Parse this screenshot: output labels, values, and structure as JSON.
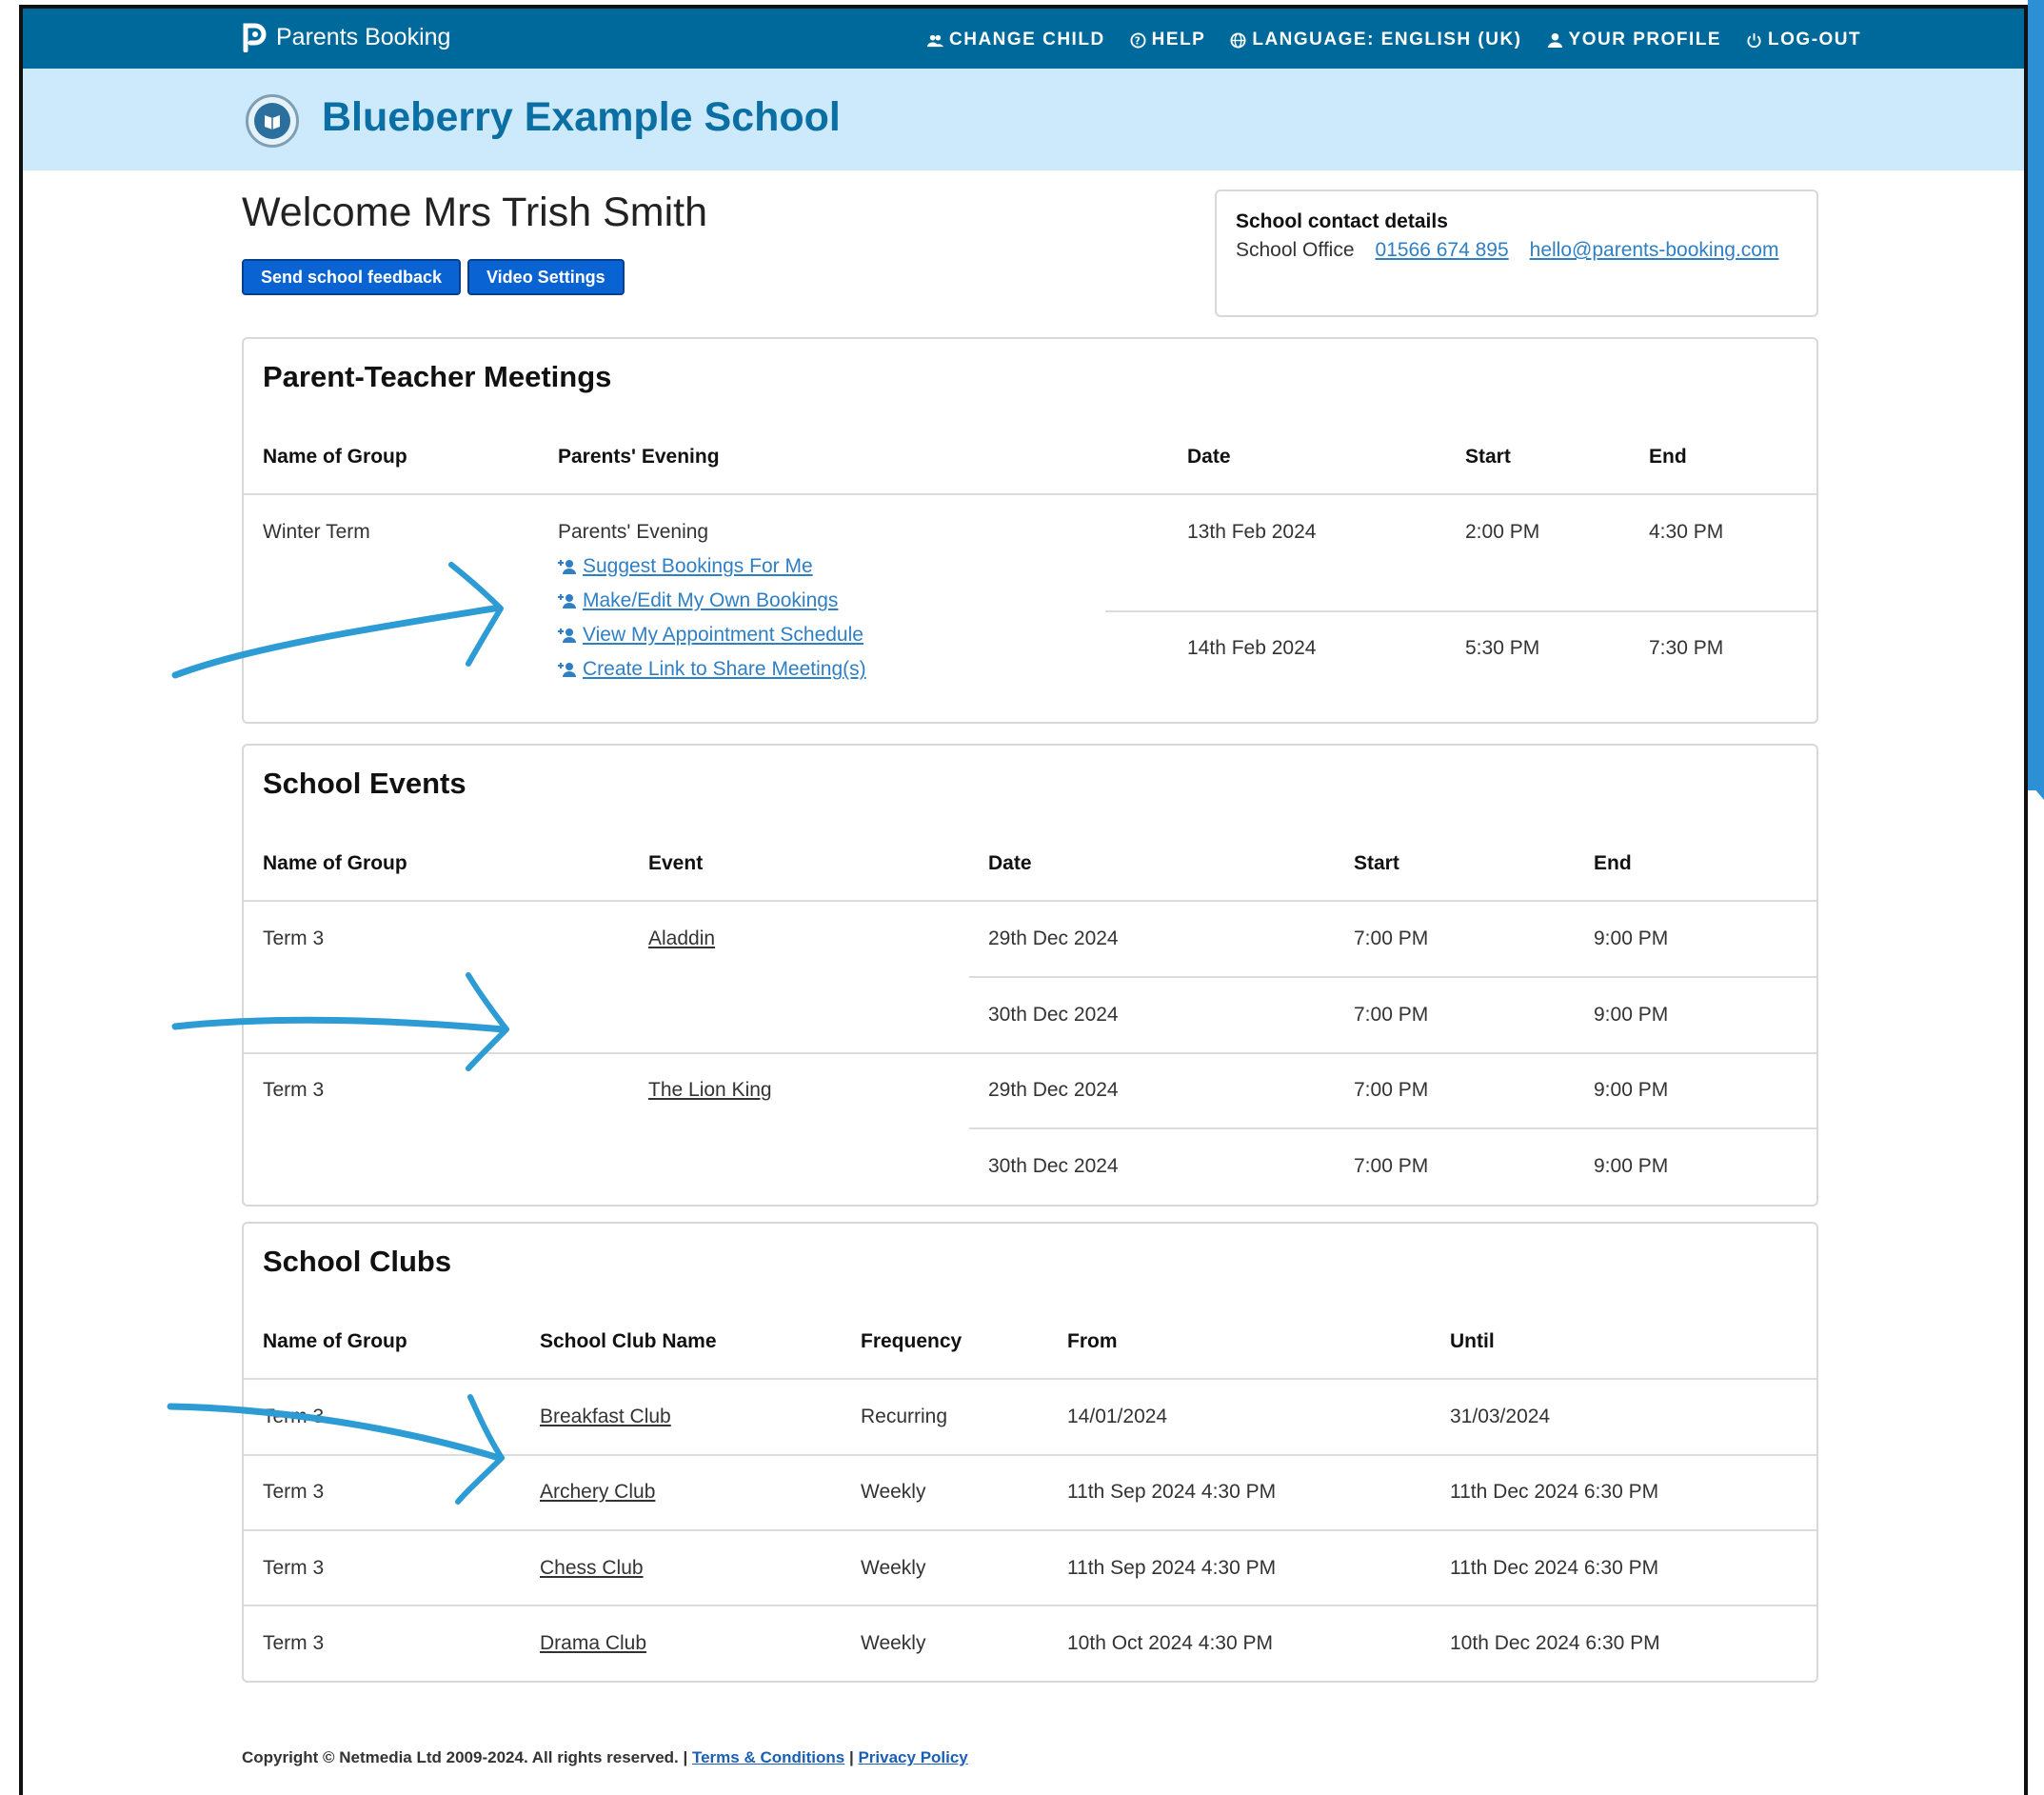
{
  "nav": {
    "brand": "Parents Booking",
    "items": [
      {
        "label": "CHANGE CHILD",
        "icon": "users-icon"
      },
      {
        "label": "HELP",
        "icon": "help-icon"
      },
      {
        "label": "LANGUAGE: ENGLISH (UK)",
        "icon": "globe-icon"
      },
      {
        "label": "YOUR PROFILE",
        "icon": "user-icon"
      },
      {
        "label": "LOG-OUT",
        "icon": "power-icon"
      }
    ]
  },
  "school": {
    "name": "Blueberry Example School"
  },
  "welcome": {
    "title": "Welcome Mrs Trish Smith",
    "feedback_button": "Send school feedback",
    "video_button": "Video Settings"
  },
  "contact": {
    "title": "School contact details",
    "label": "School Office",
    "phone": "01566 674 895",
    "email": "hello@parents-booking.com"
  },
  "meetings": {
    "title": "Parent-Teacher Meetings",
    "headers": [
      "Name of Group",
      "Parents' Evening",
      "Date",
      "Start",
      "End"
    ],
    "group": "Winter Term",
    "event": "Parents' Evening",
    "actions": [
      "Suggest Bookings For Me",
      "Make/Edit My Own Bookings",
      "View My Appointment Schedule",
      "Create Link to Share Meeting(s)"
    ],
    "sessions": [
      {
        "date": "13th Feb 2024",
        "start": "2:00 PM",
        "end": "4:30 PM"
      },
      {
        "date": "14th Feb 2024",
        "start": "5:30 PM",
        "end": "7:30 PM"
      }
    ]
  },
  "events": {
    "title": "School Events",
    "headers": [
      "Name of Group",
      "Event",
      "Date",
      "Start",
      "End"
    ],
    "rows": [
      {
        "group": "Term 3",
        "event": "Aladdin",
        "date": "29th Dec 2024",
        "start": "7:00 PM",
        "end": "9:00 PM"
      },
      {
        "group": "",
        "event": "",
        "date": "30th Dec 2024",
        "start": "7:00 PM",
        "end": "9:00 PM"
      },
      {
        "group": "Term 3",
        "event": "The Lion King",
        "date": "29th Dec 2024",
        "start": "7:00 PM",
        "end": "9:00 PM"
      },
      {
        "group": "",
        "event": "",
        "date": "30th Dec 2024",
        "start": "7:00 PM",
        "end": "9:00 PM"
      }
    ]
  },
  "clubs": {
    "title": "School Clubs",
    "headers": [
      "Name of Group",
      "School Club Name",
      "Frequency",
      "From",
      "Until"
    ],
    "rows": [
      {
        "group": "Term 3",
        "club": "Breakfast Club",
        "frequency": "Recurring",
        "from": "14/01/2024",
        "until": "31/03/2024"
      },
      {
        "group": "Term 3",
        "club": "Archery Club",
        "frequency": "Weekly",
        "from": "11th Sep 2024 4:30 PM",
        "until": "11th Dec 2024 6:30 PM"
      },
      {
        "group": "Term 3",
        "club": "Chess Club",
        "frequency": "Weekly",
        "from": "11th Sep 2024 4:30 PM",
        "until": "11th Dec 2024 6:30 PM"
      },
      {
        "group": "Term 3",
        "club": "Drama Club",
        "frequency": "Weekly",
        "from": "10th Oct 2024 4:30 PM",
        "until": "10th Dec 2024 6:30 PM"
      }
    ]
  },
  "footer": {
    "copyright": "Copyright © Netmedia Ltd 2009-2024. All rights reserved. |",
    "terms": "Terms & Conditions",
    "sep": "|",
    "privacy": "Privacy Policy"
  },
  "colors": {
    "nav_bg": "#00699b",
    "banner_bg": "#cdeafc",
    "school_name": "#0b6fa4",
    "button_bg": "#0a63d3",
    "link": "#2f7fc4",
    "annotation_arrow": "#2d9bd4"
  }
}
